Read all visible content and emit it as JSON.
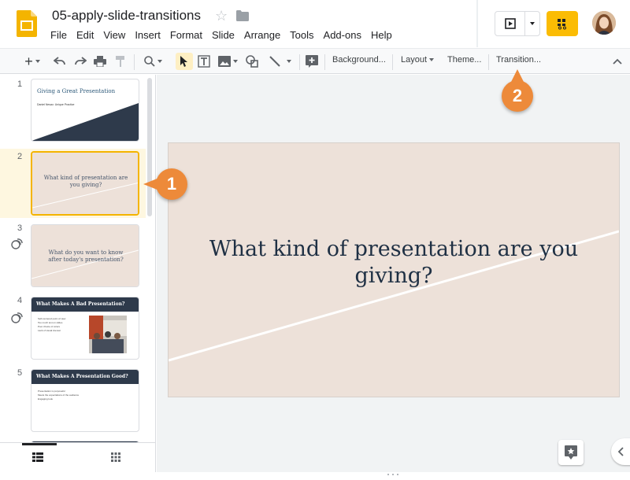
{
  "doc": {
    "title": "05-apply-slide-transitions"
  },
  "menu": [
    "File",
    "Edit",
    "View",
    "Insert",
    "Format",
    "Slide",
    "Arrange",
    "Tools",
    "Add-ons",
    "Help"
  ],
  "toolbar": {
    "background_label": "Background...",
    "layout_label": "Layout",
    "theme_label": "Theme...",
    "transition_label": "Transition..."
  },
  "slides": [
    {
      "num": "1",
      "title": "Giving a Great Presentation",
      "subtitle": "Daniel Nesac: Unique Practice"
    },
    {
      "num": "2",
      "title": "What kind of presentation are you giving?"
    },
    {
      "num": "3",
      "title": "What do you want to know after today's presentation?"
    },
    {
      "num": "4",
      "title": "What Makes A Bad Presentation?",
      "bullets": [
        "Self-centered point of view",
        "Too much text on slides",
        "Poor choice of colors",
        "Lack of visual interest"
      ]
    },
    {
      "num": "5",
      "title": "What Makes A Presentation Good?",
      "bullets": [
        "Presentation is purposeful",
        "Meets the expectations of the audience",
        "Engaging look"
      ]
    }
  ],
  "main_slide": {
    "title": "What kind of presentation are you giving?"
  },
  "callouts": {
    "one": "1",
    "two": "2"
  },
  "colors": {
    "accent": "#fbbc04",
    "callout": "#ed8a3a",
    "slide_bg": "#ede1d9",
    "title_text": "#1f3044",
    "dark_band": "#2e3a4b"
  }
}
